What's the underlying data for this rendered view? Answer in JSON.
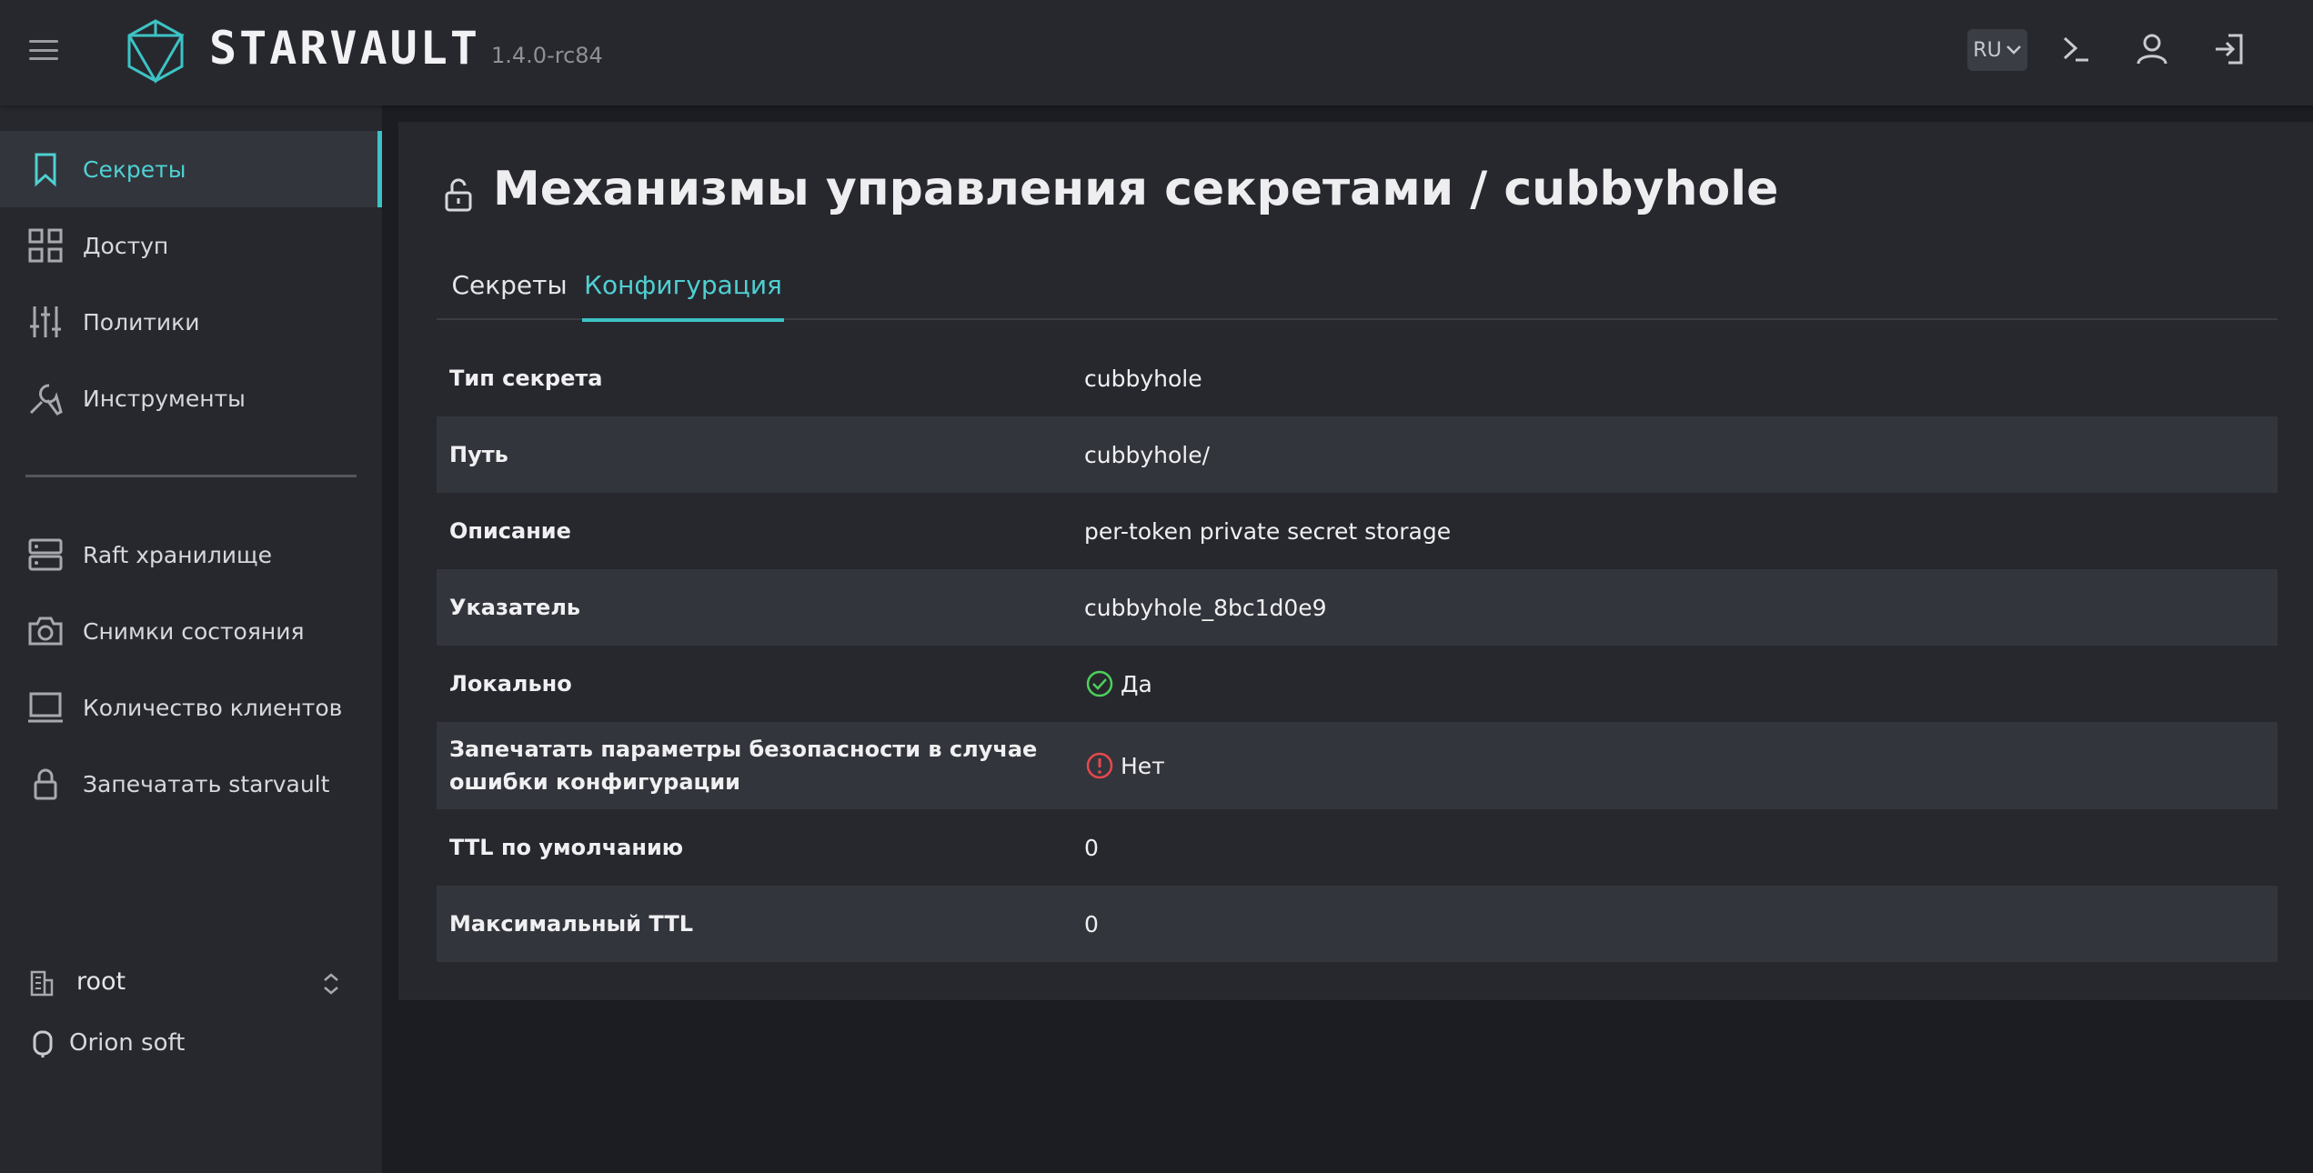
{
  "header": {
    "brand": "STARVAULT",
    "version": "1.4.0-rc84",
    "lang": "RU",
    "icons": [
      "menu-icon",
      "terminal-icon",
      "user-icon",
      "logout-icon"
    ]
  },
  "sidebar": {
    "items": [
      {
        "label": "Секреты",
        "icon": "bookmark-icon",
        "active": true
      },
      {
        "label": "Доступ",
        "icon": "grid-icon"
      },
      {
        "label": "Политики",
        "icon": "sliders-icon"
      },
      {
        "label": "Инструменты",
        "icon": "tools-icon"
      },
      {
        "label": "Raft хранилище",
        "icon": "server-icon"
      },
      {
        "label": "Снимки состояния",
        "icon": "camera-icon"
      },
      {
        "label": "Количество клиентов",
        "icon": "laptop-icon"
      },
      {
        "label": "Запечатать starvault",
        "icon": "lock-icon"
      }
    ],
    "namespace": "root",
    "org": "Orion soft"
  },
  "main": {
    "title": "Механизмы управления секретами / cubbyhole",
    "tabs": [
      {
        "label": "Секреты"
      },
      {
        "label": "Конфигурация",
        "active": true
      }
    ],
    "rows": [
      {
        "key": "Тип секрета",
        "value": "cubbyhole"
      },
      {
        "key": "Путь",
        "value": "cubbyhole/"
      },
      {
        "key": "Описание",
        "value": "per-token private secret storage"
      },
      {
        "key": "Указатель",
        "value": "cubbyhole_8bc1d0e9"
      },
      {
        "key": "Локально",
        "value": "Да",
        "status": "check-icon"
      },
      {
        "key": "Запечатать параметры безопасности в случае ошибки конфигурации",
        "value": "Нет",
        "status": "alert-icon"
      },
      {
        "key": "TTL по умолчанию",
        "value": "0"
      },
      {
        "key": "Максимальный TTL",
        "value": "0"
      }
    ]
  },
  "colors": {
    "accent": "#3cc3c5",
    "background": "#1c1d22",
    "panel": "#27282e",
    "ok": "#4ccf5a",
    "error": "#e5484d"
  }
}
